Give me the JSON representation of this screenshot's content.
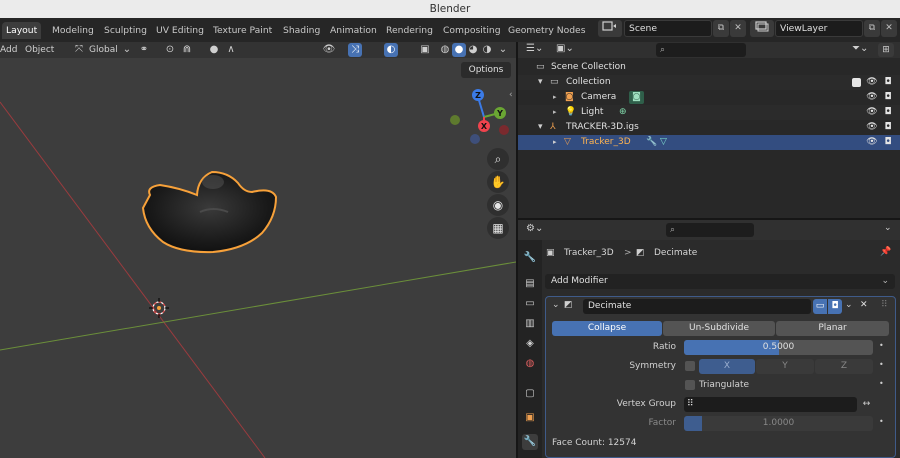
{
  "window": {
    "title": "Blender"
  },
  "workspace_tabs": [
    {
      "label": "Layout",
      "active": true
    },
    {
      "label": "Modeling",
      "active": false
    },
    {
      "label": "Sculpting",
      "active": false
    },
    {
      "label": "UV Editing",
      "active": false
    },
    {
      "label": "Texture Paint",
      "active": false
    },
    {
      "label": "Shading",
      "active": false
    },
    {
      "label": "Animation",
      "active": false
    },
    {
      "label": "Rendering",
      "active": false
    },
    {
      "label": "Compositing",
      "active": false
    },
    {
      "label": "Geometry Nodes",
      "active": false
    }
  ],
  "scene_selector": {
    "value": "Scene"
  },
  "viewlayer_selector": {
    "value": "ViewLayer"
  },
  "viewport": {
    "menu": {
      "add": "Add",
      "object": "Object"
    },
    "transform_orientation": "Global",
    "options_label": "Options",
    "gizmo_axes": {
      "x": "X",
      "y": "Y",
      "z": "Z"
    }
  },
  "outliner": {
    "search_placeholder": "",
    "items": [
      {
        "label": "Scene Collection",
        "icon": "scene-collection-icon"
      },
      {
        "label": "Collection",
        "icon": "collection-icon"
      },
      {
        "label": "Camera",
        "icon": "camera-object-icon"
      },
      {
        "label": "Light",
        "icon": "light-object-icon"
      },
      {
        "label": "TRACKER-3D.igs",
        "icon": "empty-object-icon"
      },
      {
        "label": "Tracker_3D",
        "icon": "mesh-object-icon",
        "selected": true
      }
    ]
  },
  "properties": {
    "search_placeholder": "",
    "breadcrumb": {
      "object": "Tracker_3D",
      "separator": ">",
      "modifier": "Decimate"
    },
    "add_modifier_label": "Add Modifier",
    "modifier": {
      "name": "Decimate",
      "modes": [
        "Collapse",
        "Un-Subdivide",
        "Planar"
      ],
      "active_mode": "Collapse",
      "ratio_label": "Ratio",
      "ratio_value": "0.5000",
      "ratio": 0.5,
      "symmetry_label": "Symmetry",
      "symmetry_axes": [
        "X",
        "Y",
        "Z"
      ],
      "triangulate_label": "Triangulate",
      "vertex_group_label": "Vertex Group",
      "factor_label": "Factor",
      "factor_value": "1.0000",
      "face_count_text": "Face Count: 12574"
    }
  },
  "colors": {
    "accent_blue": "#4772b3",
    "selection_orange": "#f7a13a",
    "axis_red": "#f0434d",
    "axis_green": "#6aa533",
    "axis_blue": "#3b7be7"
  }
}
